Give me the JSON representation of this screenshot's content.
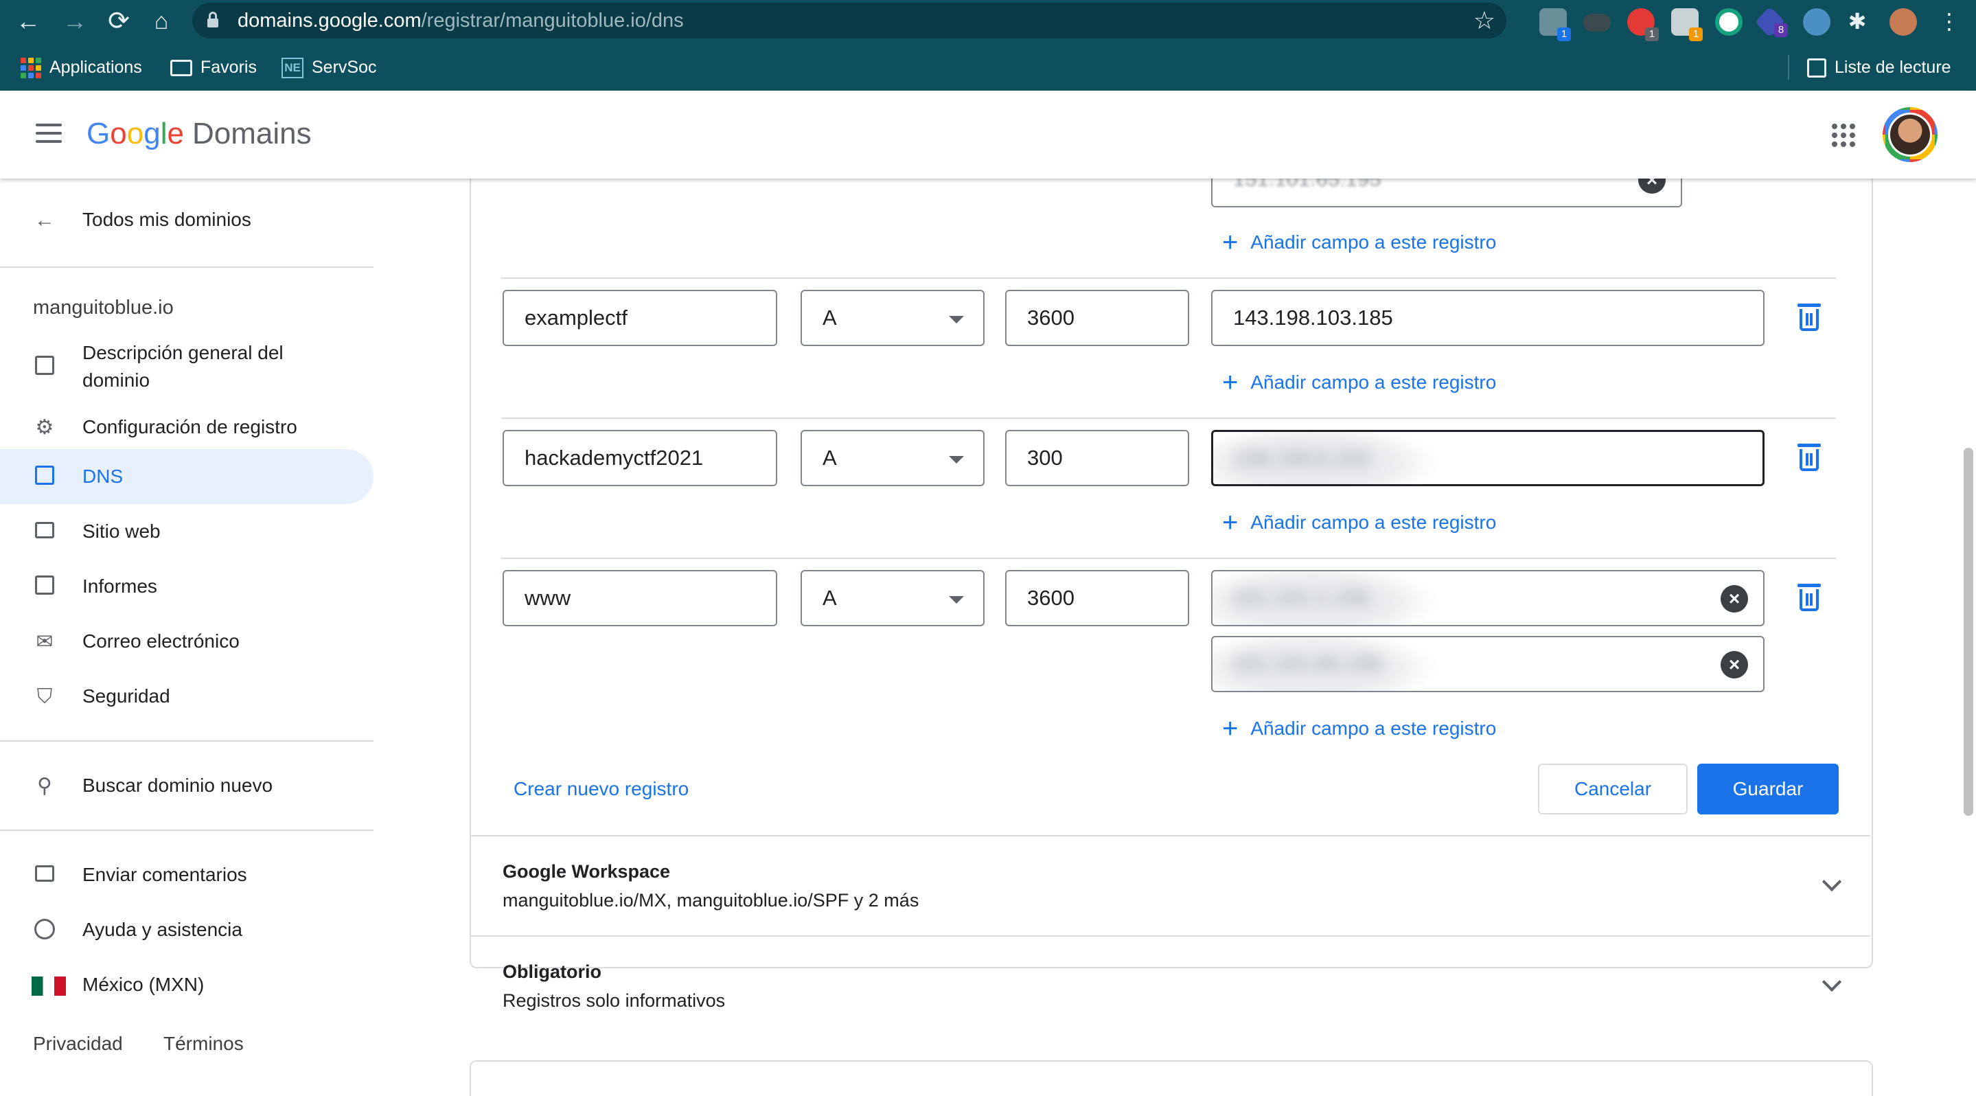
{
  "browser": {
    "url_host": "domains.google.com",
    "url_path": "/registrar/manguitoblue.io/dns",
    "extensions": [
      {
        "name": "translate-extension-icon",
        "badge": "1",
        "badge_color": "#1a73e8"
      },
      {
        "name": "gamepad-extension-icon",
        "badge": ""
      },
      {
        "name": "adblock-extension-icon",
        "badge": "1",
        "badge_color": "#5f6368"
      },
      {
        "name": "wrench-extension-icon",
        "badge": "1",
        "badge_color": "#f29900"
      },
      {
        "name": "grammarly-extension-icon",
        "badge": ""
      },
      {
        "name": "shapes-extension-icon",
        "badge": "8",
        "badge_color": "#5e35b1"
      },
      {
        "name": "compass-extension-icon",
        "badge": ""
      },
      {
        "name": "puzzle-extension-icon",
        "badge": ""
      }
    ],
    "bookmarks": [
      {
        "label": "Applications",
        "icon": "apps-grid-icon"
      },
      {
        "label": "Favoris",
        "icon": "folder-icon"
      },
      {
        "label": "ServSoc",
        "icon": "ne-icon"
      }
    ],
    "reading_list": "Liste de lecture"
  },
  "header": {
    "logo_letters": [
      "G",
      "o",
      "o",
      "g",
      "l",
      "e"
    ],
    "product": "Domains"
  },
  "sidebar": {
    "back_label": "Todos mis dominios",
    "domain": "manguitoblue.io",
    "items": [
      {
        "label": "Descripción general del dominio",
        "icon": "dashboard-icon"
      },
      {
        "label": "Configuración de registro",
        "icon": "gear-icon"
      },
      {
        "label": "DNS",
        "icon": "dns-icon"
      },
      {
        "label": "Sitio web",
        "icon": "website-icon"
      },
      {
        "label": "Informes",
        "icon": "reports-icon"
      },
      {
        "label": "Correo electrónico",
        "icon": "mail-icon"
      },
      {
        "label": "Seguridad",
        "icon": "shield-icon"
      }
    ],
    "search_label": "Buscar dominio nuevo",
    "feedback_label": "Enviar comentarios",
    "help_label": "Ayuda y asistencia",
    "currency_label": "México (MXN)",
    "privacy_label": "Privacidad",
    "terms_label": "Términos"
  },
  "records": {
    "partial_top_ip": "151.101.65.195",
    "add_field_label": "Añadir campo a este registro",
    "rows": [
      {
        "host": "examplectf",
        "type": "A",
        "ttl": "3600",
        "data": [
          "143.198.103.185"
        ]
      },
      {
        "host": "hackademyctf2021",
        "type": "A",
        "ttl": "300",
        "data": [
          "138.199.6.162"
        ]
      },
      {
        "host": "www",
        "type": "A",
        "ttl": "3600",
        "data": [
          "151.101.1.195",
          "151.101.65.195"
        ]
      }
    ],
    "create_label": "Crear nuevo registro",
    "cancel_label": "Cancelar",
    "save_label": "Guardar"
  },
  "sections": [
    {
      "title": "Google Workspace",
      "subtitle": "manguitoblue.io/MX, manguitoblue.io/SPF y 2 más"
    },
    {
      "title": "Obligatorio",
      "subtitle": "Registros solo informativos"
    }
  ],
  "colors": {
    "chrome_bg": "#0d4f5c",
    "accent": "#1a73e8",
    "active_nav_bg": "#e8f0fe"
  }
}
